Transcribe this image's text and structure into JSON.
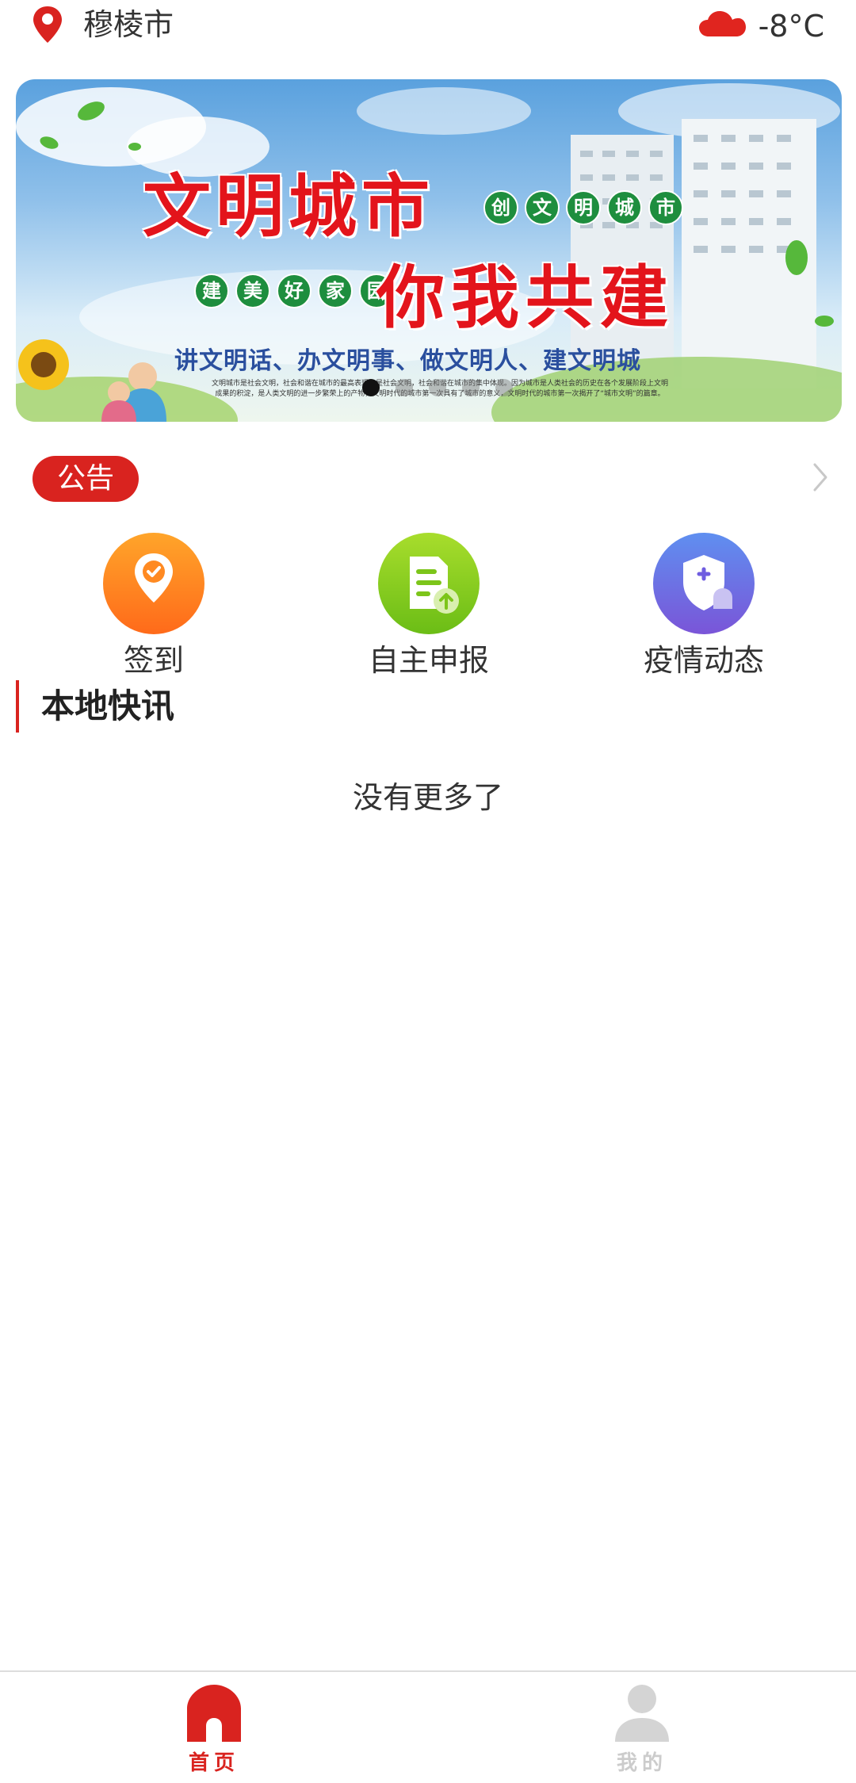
{
  "header": {
    "city": "穆棱市",
    "temperature": "-8°C",
    "location_icon": "location-pin-icon",
    "weather_icon": "cloud-icon"
  },
  "banner": {
    "title_line1": "文明城市",
    "title_line2": "你我共建",
    "chips_top": [
      "创",
      "文",
      "明",
      "城",
      "市"
    ],
    "chips_bottom": [
      "建",
      "美",
      "好",
      "家",
      "园"
    ],
    "slogan": "讲文明话、办文明事、做文明人、建文明城",
    "small_text": "文明城市是社会文明，社会和谐在城市的最高表现，是社会文明，社会和谐在城市的集中体现。因为城市是人类社会的历史在各个发展阶段上文明成果的积淀，是人类文明的进一步繁荣上的产物，文明时代的城市第一次具有了城市的意义，文明时代的城市第一次揭开了“城市文明”的篇章。",
    "slides": 5,
    "active_slide": 0
  },
  "notice": {
    "badge": "公告"
  },
  "actions": [
    {
      "label": "签到",
      "icon": "check-in-pin-icon",
      "color": "#ff7a1a"
    },
    {
      "label": "自主申报",
      "icon": "document-upload-icon",
      "color": "#7cc51a"
    },
    {
      "label": "疫情动态",
      "icon": "shield-plus-icon",
      "color": "#6f5ce0"
    }
  ],
  "section": {
    "title": "本地快讯"
  },
  "list": {
    "empty_text": "没有更多了"
  },
  "tabbar": {
    "tabs": [
      {
        "label": "首页",
        "icon": "home-icon",
        "active": true
      },
      {
        "label": "我的",
        "icon": "user-icon",
        "active": false
      }
    ]
  },
  "colors": {
    "accent": "#d9231f",
    "text": "#333333"
  }
}
